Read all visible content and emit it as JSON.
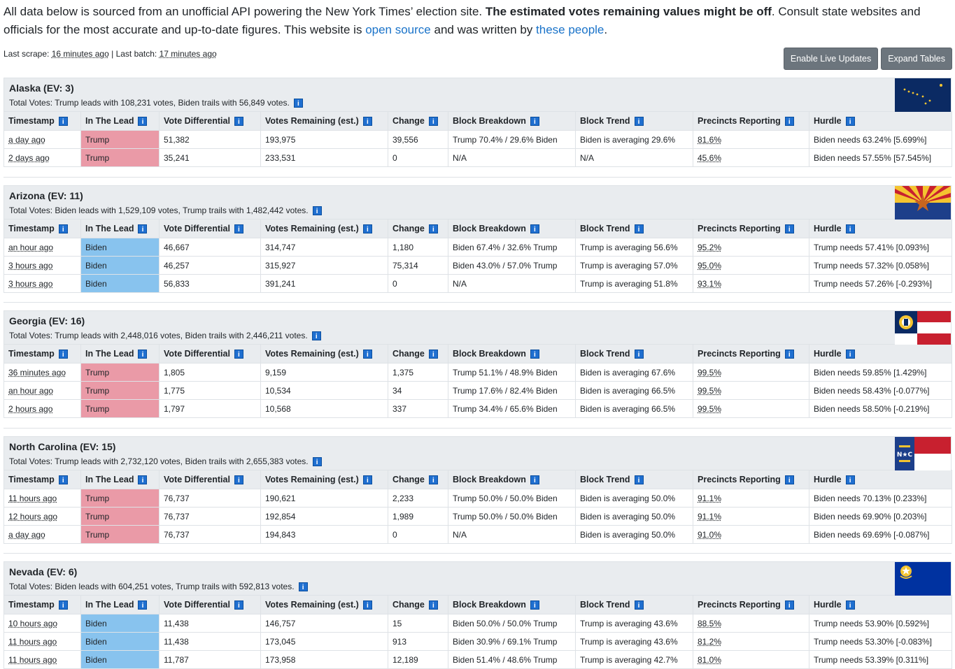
{
  "intro": {
    "text1": "All data below is sourced from an unofficial API powering the New York Times’ election site. ",
    "bold": "The estimated votes remaining values might be off",
    "text2": ". Consult state websites and officials for the most accurate and up-to-date figures. This website is ",
    "link1": "open source",
    "text3": " and was written by ",
    "link2": "these people",
    "text4": "."
  },
  "scrape": {
    "last_scrape_label": "Last scrape: ",
    "last_scrape": "16 minutes ago",
    "sep": " | ",
    "last_batch_label": "Last batch: ",
    "last_batch": "17 minutes ago"
  },
  "buttons": {
    "live": "Enable Live Updates",
    "expand": "Expand Tables"
  },
  "columns": [
    "Timestamp",
    "In The Lead",
    "Vote Differential",
    "Votes Remaining (est.)",
    "Change",
    "Block Breakdown",
    "Block Trend",
    "Precincts Reporting",
    "Hurdle"
  ],
  "info_glyph": "i",
  "colors": {
    "trump": "#ea9aa7",
    "biden": "#88c3ee"
  },
  "states": [
    {
      "name": "Alaska (EV: 3)",
      "totals": "Total Votes: Trump leads with 108,231 votes, Biden trails with 56,849 votes.",
      "flag": "alaska-flag",
      "rows": [
        [
          "a day ago",
          "Trump",
          "51,382",
          "193,975",
          "39,556",
          "Trump 70.4% / 29.6% Biden",
          "Biden is averaging 29.6%",
          "81.6%",
          "Biden needs 63.24% [5.699%]"
        ],
        [
          "2 days ago",
          "Trump",
          "35,241",
          "233,531",
          "0",
          "N/A",
          "N/A",
          "45.6%",
          "Biden needs 57.55% [57.545%]"
        ]
      ]
    },
    {
      "name": "Arizona (EV: 11)",
      "totals": "Total Votes: Biden leads with 1,529,109 votes, Trump trails with 1,482,442 votes.",
      "flag": "arizona-flag",
      "rows": [
        [
          "an hour ago",
          "Biden",
          "46,667",
          "314,747",
          "1,180",
          "Biden 67.4% / 32.6% Trump",
          "Trump is averaging 56.6%",
          "95.2%",
          "Trump needs 57.41% [0.093%]"
        ],
        [
          "3 hours ago",
          "Biden",
          "46,257",
          "315,927",
          "75,314",
          "Biden 43.0% / 57.0% Trump",
          "Trump is averaging 57.0%",
          "95.0%",
          "Trump needs 57.32% [0.058%]"
        ],
        [
          "3 hours ago",
          "Biden",
          "56,833",
          "391,241",
          "0",
          "N/A",
          "Trump is averaging 51.8%",
          "93.1%",
          "Trump needs 57.26% [-0.293%]"
        ]
      ]
    },
    {
      "name": "Georgia (EV: 16)",
      "totals": "Total Votes: Trump leads with 2,448,016 votes, Biden trails with 2,446,211 votes.",
      "flag": "georgia-flag",
      "rows": [
        [
          "36 minutes ago",
          "Trump",
          "1,805",
          "9,159",
          "1,375",
          "Trump 51.1% / 48.9% Biden",
          "Biden is averaging 67.6%",
          "99.5%",
          "Biden needs 59.85% [1.429%]"
        ],
        [
          "an hour ago",
          "Trump",
          "1,775",
          "10,534",
          "34",
          "Trump 17.6% / 82.4% Biden",
          "Biden is averaging 66.5%",
          "99.5%",
          "Biden needs 58.43% [-0.077%]"
        ],
        [
          "2 hours ago",
          "Trump",
          "1,797",
          "10,568",
          "337",
          "Trump 34.4% / 65.6% Biden",
          "Biden is averaging 66.5%",
          "99.5%",
          "Biden needs 58.50% [-0.219%]"
        ]
      ]
    },
    {
      "name": "North Carolina (EV: 15)",
      "totals": "Total Votes: Trump leads with 2,732,120 votes, Biden trails with 2,655,383 votes.",
      "flag": "north-carolina-flag",
      "rows": [
        [
          "11 hours ago",
          "Trump",
          "76,737",
          "190,621",
          "2,233",
          "Trump 50.0% / 50.0% Biden",
          "Biden is averaging 50.0%",
          "91.1%",
          "Biden needs 70.13% [0.233%]"
        ],
        [
          "12 hours ago",
          "Trump",
          "76,737",
          "192,854",
          "1,989",
          "Trump 50.0% / 50.0% Biden",
          "Biden is averaging 50.0%",
          "91.1%",
          "Biden needs 69.90% [0.203%]"
        ],
        [
          "a day ago",
          "Trump",
          "76,737",
          "194,843",
          "0",
          "N/A",
          "Biden is averaging 50.0%",
          "91.0%",
          "Biden needs 69.69% [-0.087%]"
        ]
      ]
    },
    {
      "name": "Nevada (EV: 6)",
      "totals": "Total Votes: Biden leads with 604,251 votes, Trump trails with 592,813 votes.",
      "flag": "nevada-flag",
      "rows": [
        [
          "10 hours ago",
          "Biden",
          "11,438",
          "146,757",
          "15",
          "Biden 50.0% / 50.0% Trump",
          "Trump is averaging 43.6%",
          "88.5%",
          "Trump needs 53.90% [0.592%]"
        ],
        [
          "11 hours ago",
          "Biden",
          "11,438",
          "173,045",
          "913",
          "Biden 30.9% / 69.1% Trump",
          "Trump is averaging 43.6%",
          "81.2%",
          "Trump needs 53.30% [-0.083%]"
        ],
        [
          "11 hours ago",
          "Biden",
          "11,787",
          "173,958",
          "12,189",
          "Biden 51.4% / 48.6% Trump",
          "Trump is averaging 42.7%",
          "81.0%",
          "Trump needs 53.39% [0.311%]"
        ]
      ]
    }
  ]
}
